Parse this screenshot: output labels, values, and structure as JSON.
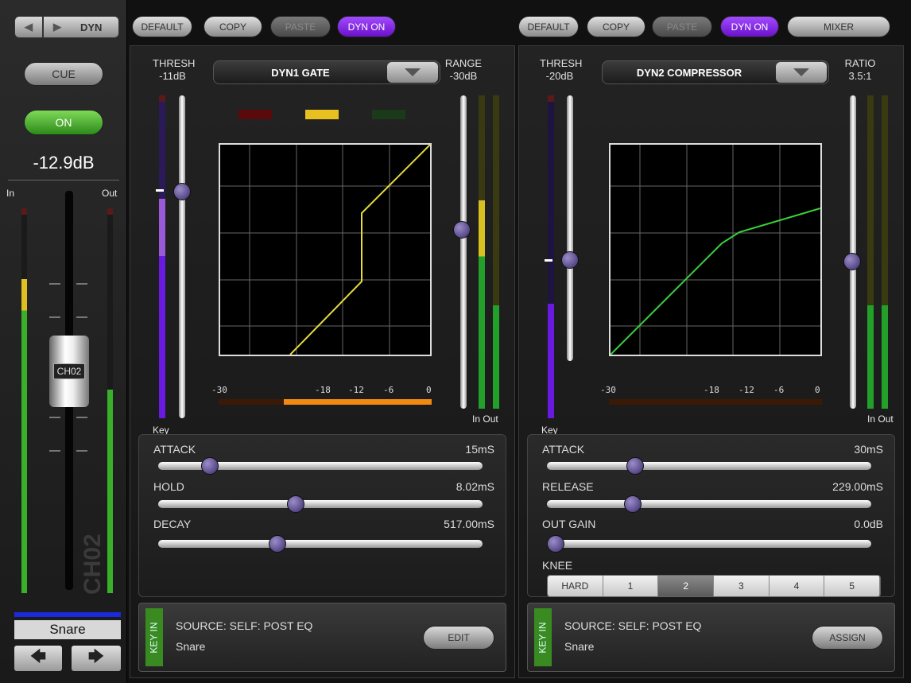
{
  "sidebar": {
    "nav_label": "DYN",
    "cue": "CUE",
    "on": "ON",
    "level": "-12.9dB",
    "in": "In",
    "out": "Out",
    "fader_cap": "CH02",
    "channel_watermark": "CH02",
    "channel_name": "Snare"
  },
  "topbar": {
    "left": {
      "default": "DEFAULT",
      "copy": "COPY",
      "paste": "PASTE",
      "dyn_on": "DYN ON"
    },
    "right": {
      "default": "DEFAULT",
      "copy": "COPY",
      "paste": "PASTE",
      "dyn_on": "DYN ON",
      "mixer": "MIXER"
    }
  },
  "dyn1": {
    "thresh_label": "THRESH",
    "thresh": "-11dB",
    "type": "DYN1 GATE",
    "range_label": "RANGE",
    "range": "-30dB",
    "key": "Key",
    "in": "In",
    "out": "Out",
    "scale": [
      "-30",
      "-18",
      "-12",
      "-6",
      "0"
    ],
    "params": [
      {
        "label": "ATTACK",
        "value": "15mS",
        "pos": 0.14
      },
      {
        "label": "HOLD",
        "value": "8.02mS",
        "pos": 0.42
      },
      {
        "label": "DECAY",
        "value": "517.00mS",
        "pos": 0.36
      }
    ],
    "key_in": "KEY IN",
    "source": "SOURCE:  SELF: POST EQ",
    "source_name": "Snare",
    "button": "EDIT"
  },
  "dyn2": {
    "thresh_label": "THRESH",
    "thresh": "-20dB",
    "type": "DYN2 COMPRESSOR",
    "ratio_label": "RATIO",
    "ratio": "3.5:1",
    "key": "Key",
    "in": "In",
    "out": "Out",
    "scale": [
      "-30",
      "-18",
      "-12",
      "-6",
      "0"
    ],
    "params": [
      {
        "label": "ATTACK",
        "value": "30mS",
        "pos": 0.26
      },
      {
        "label": "RELEASE",
        "value": "229.00mS",
        "pos": 0.25
      },
      {
        "label": "OUT GAIN",
        "value": "0.0dB",
        "pos": 0.0
      }
    ],
    "knee_label": "KNEE",
    "knee_options": [
      "HARD",
      "1",
      "2",
      "3",
      "4",
      "5"
    ],
    "knee_selected": "2",
    "key_in": "KEY IN",
    "source": "SOURCE:  SELF: POST EQ",
    "source_name": "Snare",
    "button": "ASSIGN"
  },
  "colors": {
    "gate_curve": "#e6dc3a",
    "comp_curve": "#3ad23a",
    "accent": "#7a2fe0"
  }
}
